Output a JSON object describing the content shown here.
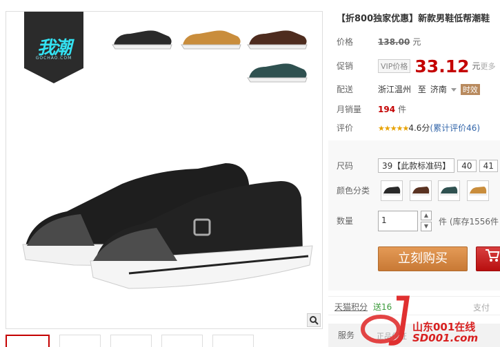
{
  "brand": {
    "logo_text": "我潮",
    "logo_sub": "GOCHAO.COM"
  },
  "product": {
    "title": "【折800独家优惠】新款男鞋低帮潮鞋",
    "price_label": "价格",
    "original_price": "138.00",
    "currency_unit": "元",
    "promo_label": "促销",
    "vip_label": "VIP价格",
    "promo_price": "33.12",
    "promo_unit": "元",
    "more_label": "更多",
    "shipping_label": "配送",
    "ship_from": "浙江温州",
    "ship_to_word": "至",
    "ship_to": "济南",
    "time_badge": "时效",
    "monthly_sales_label": "月销量",
    "monthly_sales": "194",
    "sales_unit": "件",
    "rating_label": "评价",
    "stars": "★★★★★",
    "rating_score": "4.6分",
    "rating_link": "(累计评价46)"
  },
  "sku": {
    "size_label": "尺码",
    "sizes": [
      "39【此款标准码】",
      "40",
      "41"
    ],
    "color_label": "颜色分类",
    "colors": [
      {
        "name": "black",
        "hex": "#2a2a2a"
      },
      {
        "name": "brown",
        "hex": "#5a3322"
      },
      {
        "name": "green",
        "hex": "#2f5150"
      },
      {
        "name": "tan",
        "hex": "#c98d3c"
      }
    ],
    "qty_label": "数量",
    "qty_value": "1",
    "qty_up": "▲",
    "qty_down": "▼",
    "stock_text": "件 (库存1556件"
  },
  "actions": {
    "buy_now": "立刻购买",
    "cart_icon": "cart-icon"
  },
  "points": {
    "label": "天猫积分",
    "value": "送16",
    "pay_label": "支付"
  },
  "service": {
    "label": "服务",
    "sub": "正品保证"
  },
  "watermark": {
    "line1": "山东001在线",
    "line2": "SD001.com"
  },
  "colors": {
    "price_red": "#c40000",
    "buy_orange": "#d98a45",
    "cart_red": "#c41818"
  }
}
